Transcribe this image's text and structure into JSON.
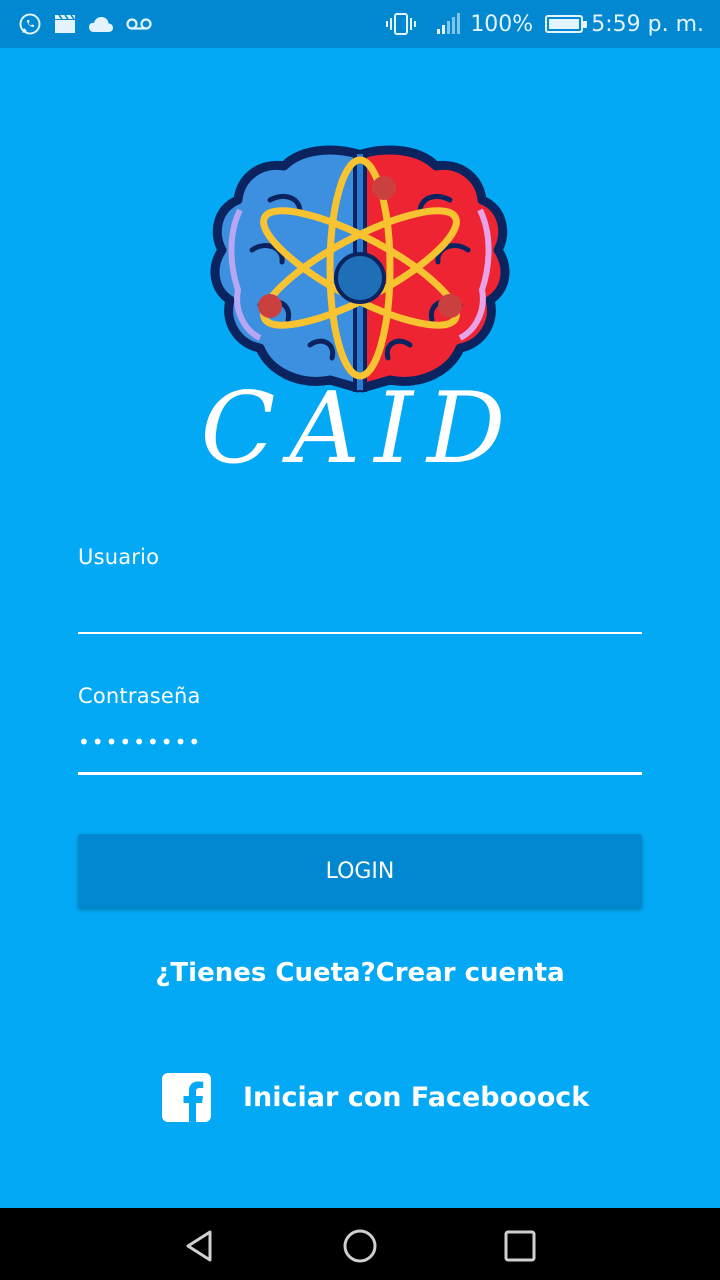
{
  "status_bar": {
    "notification_icons": [
      "whatsapp-icon",
      "clapperboard-icon",
      "cloud-icon",
      "voicemail-icon"
    ],
    "system_icons": [
      "vibrate-icon",
      "signal-icon"
    ],
    "battery_text": "100%",
    "battery_level": 1.0,
    "time": "5:59 p. m."
  },
  "logo": {
    "text": "CAID",
    "icon": "brain-atom-icon"
  },
  "form": {
    "username_label": "Usuario",
    "username_value": "",
    "password_label": "Contraseña",
    "password_value": "•••••••••",
    "login_label": "LOGIN"
  },
  "links": {
    "create_account": "¿Tienes Cueta?Crear cuenta",
    "facebook_login": "Iniciar con Facebooock"
  },
  "navigation": {
    "buttons": [
      "back-icon",
      "home-icon",
      "recents-icon"
    ]
  },
  "colors": {
    "background": "#03A9F4",
    "status_bar": "#0288D1",
    "button": "#0288D1",
    "text": "#FFFFFF"
  }
}
